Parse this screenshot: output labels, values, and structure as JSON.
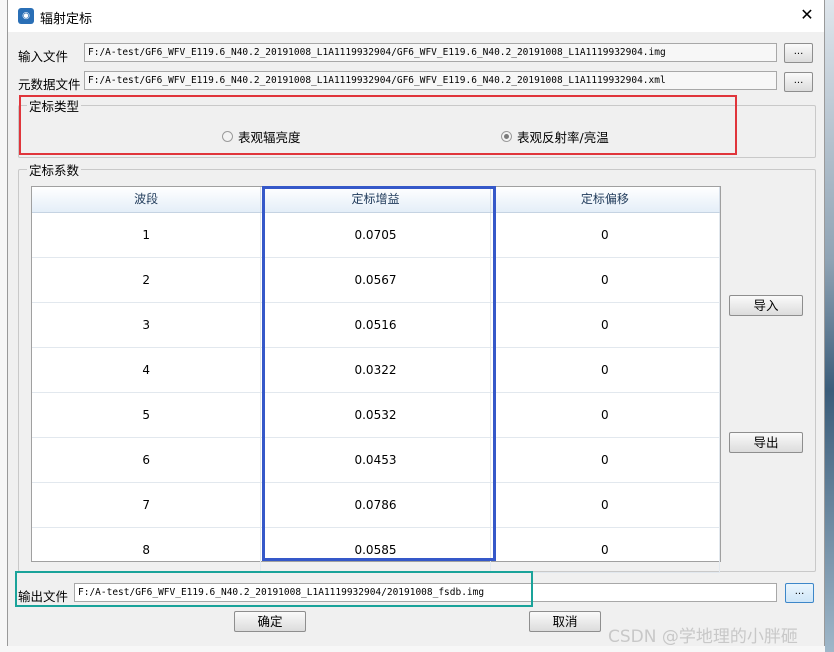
{
  "window": {
    "title": "辐射定标",
    "icon": "app-icon",
    "close_glyph": "✕"
  },
  "input_file": {
    "label": "输入文件",
    "value": "F:/A-test/GF6_WFV_E119.6_N40.2_20191008_L1A1119932904/GF6_WFV_E119.6_N40.2_20191008_L1A1119932904.img",
    "browse": "..."
  },
  "metadata_file": {
    "label": "元数据文件",
    "value": "F:/A-test/GF6_WFV_E119.6_N40.2_20191008_L1A1119932904/GF6_WFV_E119.6_N40.2_20191008_L1A1119932904.xml",
    "browse": "..."
  },
  "calib_type": {
    "legend": "定标类型",
    "options": [
      {
        "label": "表观辐亮度",
        "selected": false
      },
      {
        "label": "表观反射率/亮温",
        "selected": true
      }
    ]
  },
  "coeffs": {
    "legend": "定标系数",
    "columns": [
      "波段",
      "定标增益",
      "定标偏移"
    ],
    "rows": [
      [
        "1",
        "0.0705",
        "0"
      ],
      [
        "2",
        "0.0567",
        "0"
      ],
      [
        "3",
        "0.0516",
        "0"
      ],
      [
        "4",
        "0.0322",
        "0"
      ],
      [
        "5",
        "0.0532",
        "0"
      ],
      [
        "6",
        "0.0453",
        "0"
      ],
      [
        "7",
        "0.0786",
        "0"
      ],
      [
        "8",
        "0.0585",
        "0"
      ]
    ],
    "import_label": "导入",
    "export_label": "导出"
  },
  "output_file": {
    "label": "输出文件",
    "value": "F:/A-test/GF6_WFV_E119.6_N40.2_20191008_L1A1119932904/20191008_fsdb.img",
    "browse": "..."
  },
  "actions": {
    "ok": "确定",
    "cancel": "取消"
  },
  "watermark": "CSDN @学地理的小胖砸",
  "colors": {
    "highlight_red": "#e0353b",
    "highlight_blue": "#3558c9",
    "highlight_teal": "#1aa39a"
  }
}
